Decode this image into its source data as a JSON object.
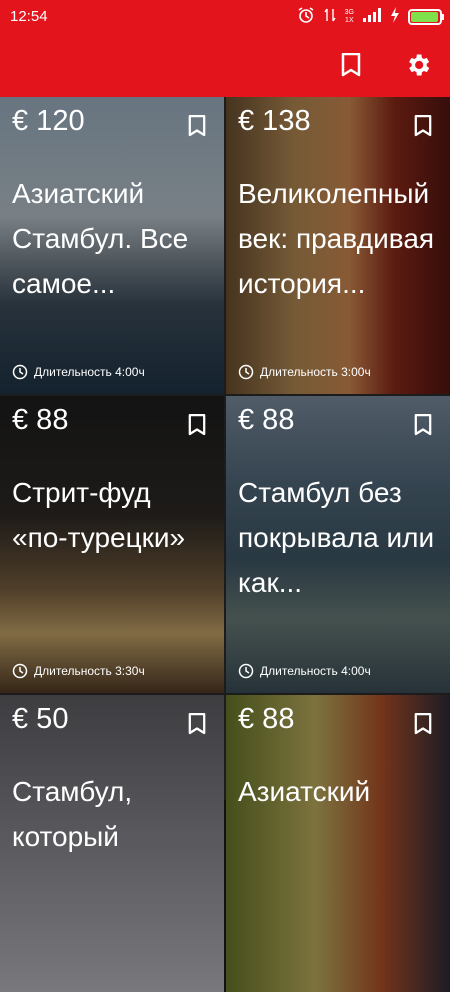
{
  "status": {
    "time": "12:54",
    "network_top": "3G",
    "network_bottom": "1X"
  },
  "toolbar": {
    "bookmark_icon": "bookmark-outline-icon",
    "settings_icon": "gear-icon"
  },
  "cards": [
    {
      "price": "€ 120",
      "title": "Азиатский Стамбул. Все самое...",
      "duration": "Длительность 4:00ч"
    },
    {
      "price": "€ 138",
      "title": "Великолепный век: правдивая история...",
      "duration": "Длительность 3:00ч"
    },
    {
      "price": "€ 88",
      "title": "Стрит-фуд «по-турецки»",
      "duration": "Длительность 3:30ч"
    },
    {
      "price": "€ 88",
      "title": "Стамбул без покрывала или как...",
      "duration": "Длительность 4:00ч"
    },
    {
      "price": "€ 50",
      "title": "Стамбул, который",
      "duration": ""
    },
    {
      "price": "€ 88",
      "title": "Азиатский",
      "duration": ""
    }
  ],
  "colors": {
    "accent": "#e4141d",
    "text": "#ffffff"
  }
}
